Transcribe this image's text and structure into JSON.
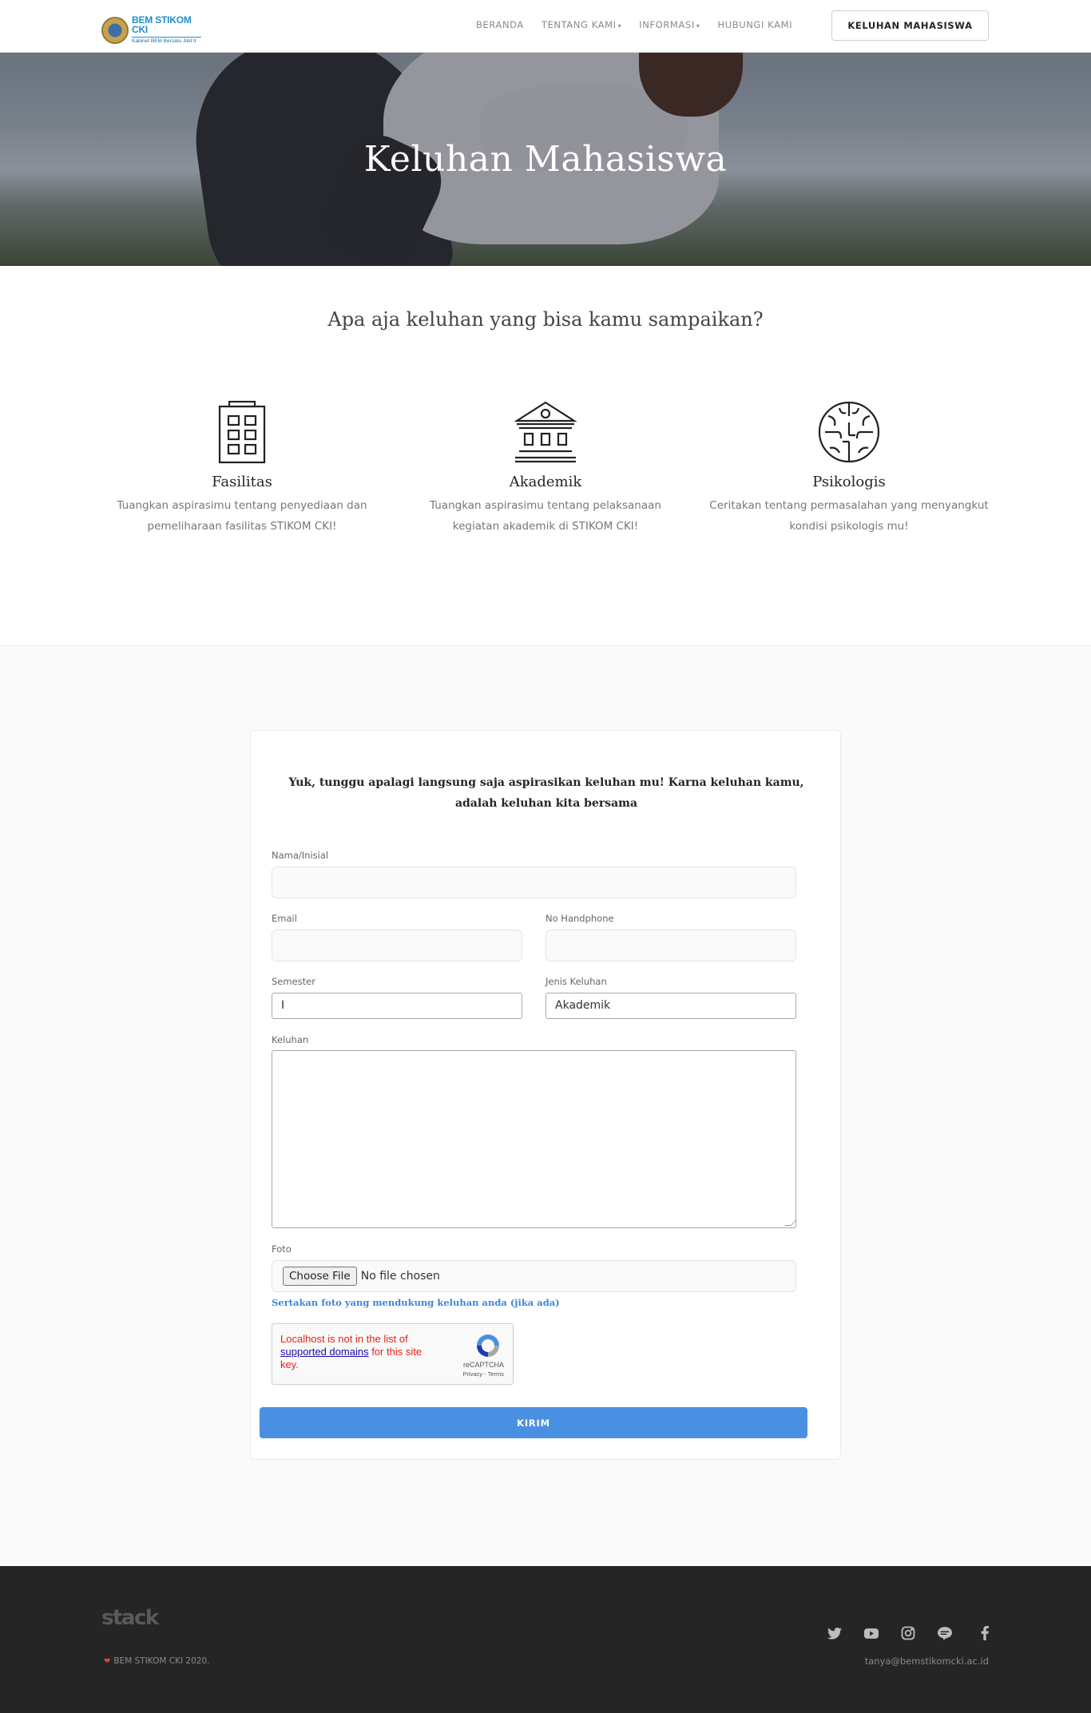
{
  "nav": {
    "logo_title": "BEM STIKOM CKI",
    "logo_subtitle": "Kabinet BEM Bersatu Jilid II",
    "items": [
      {
        "label": "BERANDA",
        "dropdown": false
      },
      {
        "label": "TENTANG KAMI",
        "dropdown": true
      },
      {
        "label": "INFORMASI",
        "dropdown": true
      },
      {
        "label": "HUBUNGI KAMI",
        "dropdown": false
      }
    ],
    "cta_label": "KELUHAN MAHASISWA"
  },
  "hero": {
    "title": "Keluhan Mahasiswa"
  },
  "features": {
    "title": "Apa aja keluhan yang bisa kamu sampaikan?",
    "items": [
      {
        "icon": "building-icon",
        "title": "Fasilitas",
        "text": "Tuangkan aspirasimu tentang penyediaan dan pemeliharaan fasilitas STIKOM CKI!"
      },
      {
        "icon": "institution-icon",
        "title": "Akademik",
        "text": "Tuangkan aspirasimu tentang pelaksanaan kegiatan akademik di STIKOM CKI!"
      },
      {
        "icon": "brain-icon",
        "title": "Psikologis",
        "text": "Ceritakan tentang permasalahan yang menyangkut kondisi psikologis mu!"
      }
    ]
  },
  "form": {
    "heading": "Yuk, tunggu apalagi langsung saja aspirasikan keluhan mu! Karna keluhan kamu, adalah keluhan kita bersama",
    "name_label": "Nama/Inisial",
    "name_value": "",
    "email_label": "Email",
    "email_value": "",
    "phone_label": "No Handphone",
    "phone_value": "",
    "semester_label": "Semester",
    "semester_value": "I",
    "type_label": "Jenis Keluhan",
    "type_value": "Akademik",
    "complaint_label": "Keluhan",
    "complaint_value": "",
    "photo_label": "Foto",
    "file_button": "Choose File",
    "file_status": "No file chosen",
    "photo_hint": "Sertakan foto yang mendukung keluhan anda (jika ada)",
    "captcha": {
      "error_prefix": "Localhost is not in the list of ",
      "error_link": "supported domains",
      "error_suffix": " for this site key.",
      "brand": "reCAPTCHA",
      "links": "Privacy - Terms"
    },
    "submit_label": "KIRIM",
    "accent_color": "#4a90e2"
  },
  "footer": {
    "logo": "stack",
    "copyright": "BEM STIKOM CKI 2020.",
    "email": "tanya@bemstikomcki.ac.id",
    "social_icons": [
      "twitter-icon",
      "youtube-icon",
      "instagram-icon",
      "line-icon",
      "facebook-icon"
    ]
  }
}
